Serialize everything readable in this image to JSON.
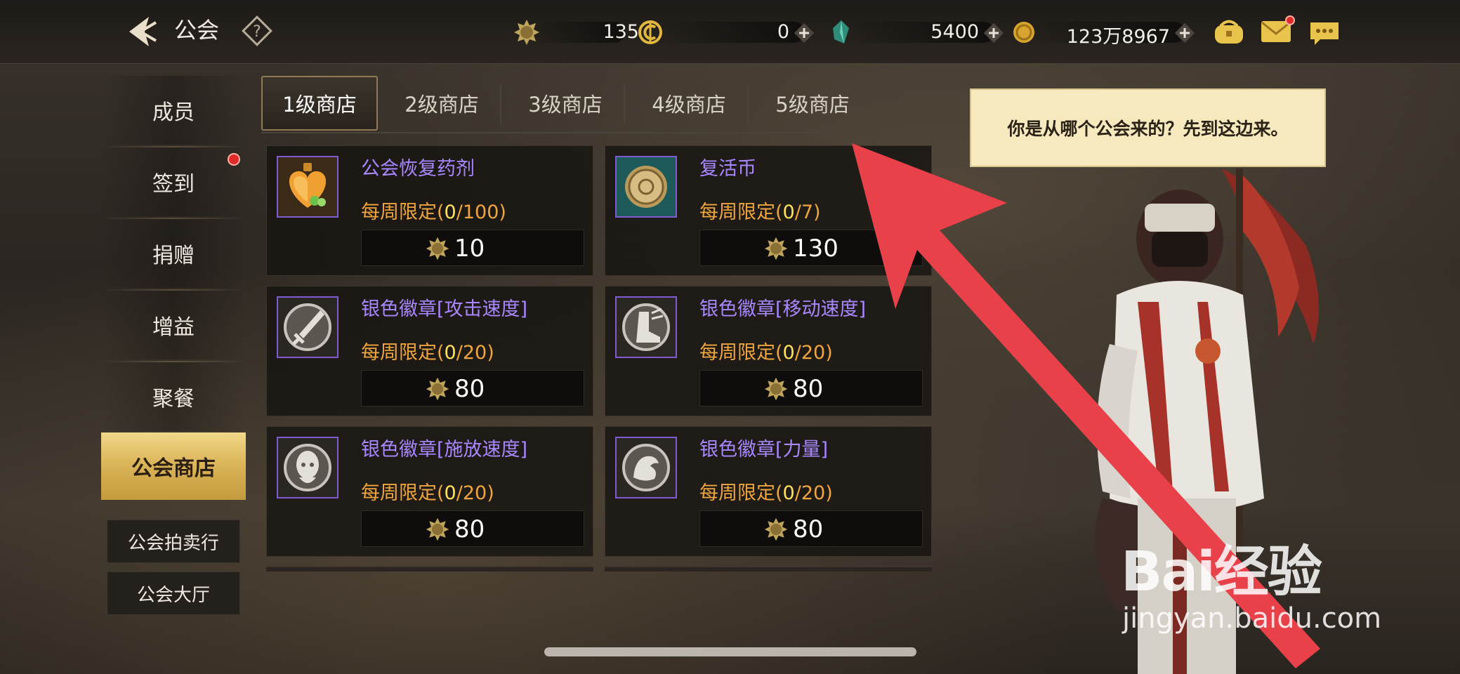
{
  "header": {
    "title": "公会",
    "icons": [
      "back-arrow-icon",
      "help-question-icon"
    ]
  },
  "currencies": [
    {
      "name": "guild-coin",
      "icon": "guild-coin-icon",
      "value": "135",
      "has_plus": false
    },
    {
      "name": "c-currency",
      "icon": "c-coin-icon",
      "value": "0",
      "has_plus": true
    },
    {
      "name": "crystal",
      "icon": "crystal-icon",
      "value": "5400",
      "has_plus": true
    },
    {
      "name": "gold",
      "icon": "gold-coin-icon",
      "value": "123万8967",
      "has_plus": true
    }
  ],
  "top_right_icons": [
    "purse-icon",
    "mail-icon",
    "chat-icon"
  ],
  "sidebar": {
    "items": [
      {
        "label": "成员",
        "active": false
      },
      {
        "label": "签到",
        "active": false,
        "badge": true
      },
      {
        "label": "捐赠",
        "active": false
      },
      {
        "label": "增益",
        "active": false
      },
      {
        "label": "聚餐",
        "active": false
      },
      {
        "label": "公会商店",
        "active": true
      }
    ],
    "buttons": [
      {
        "label": "公会拍卖行"
      },
      {
        "label": "公会大厅"
      }
    ]
  },
  "tabs": [
    {
      "label": "1级商店",
      "active": true
    },
    {
      "label": "2级商店",
      "active": false
    },
    {
      "label": "3级商店",
      "active": false
    },
    {
      "label": "4级商店",
      "active": false
    },
    {
      "label": "5级商店",
      "active": false
    }
  ],
  "shop_items": [
    {
      "name": "公会恢复药剂",
      "limit_prefix": "每周限定(",
      "used": "0",
      "limit_suffix": "/100)",
      "price": "10",
      "icon": "heart-potion-icon"
    },
    {
      "name": "复活币",
      "limit_prefix": "每周限定(",
      "used": "0",
      "limit_suffix": "/7)",
      "price": "130",
      "icon": "revival-coin-icon"
    },
    {
      "name": "银色徽章[攻击速度]",
      "limit_prefix": "每周限定(",
      "used": "0",
      "limit_suffix": "/20)",
      "price": "80",
      "icon": "sword-badge-icon"
    },
    {
      "name": "银色徽章[移动速度]",
      "limit_prefix": "每周限定(",
      "used": "0",
      "limit_suffix": "/20)",
      "price": "80",
      "icon": "boot-badge-icon"
    },
    {
      "name": "银色徽章[施放速度]",
      "limit_prefix": "每周限定(",
      "used": "0",
      "limit_suffix": "/20)",
      "price": "80",
      "icon": "head-badge-icon"
    },
    {
      "name": "银色徽章[力量]",
      "limit_prefix": "每周限定(",
      "used": "0",
      "limit_suffix": "/20)",
      "price": "80",
      "icon": "arm-badge-icon"
    }
  ],
  "npc": {
    "dialog": "你是从哪个公会来的？先到这边来。"
  },
  "watermark": {
    "brand": "Bai经验",
    "url": "jingyan.baidu.com"
  },
  "colors": {
    "active_gold": "#dcb65a",
    "item_name_purple": "#a987ff",
    "limit_orange": "#f0a640",
    "annotation_arrow_red": "#e8414a"
  }
}
